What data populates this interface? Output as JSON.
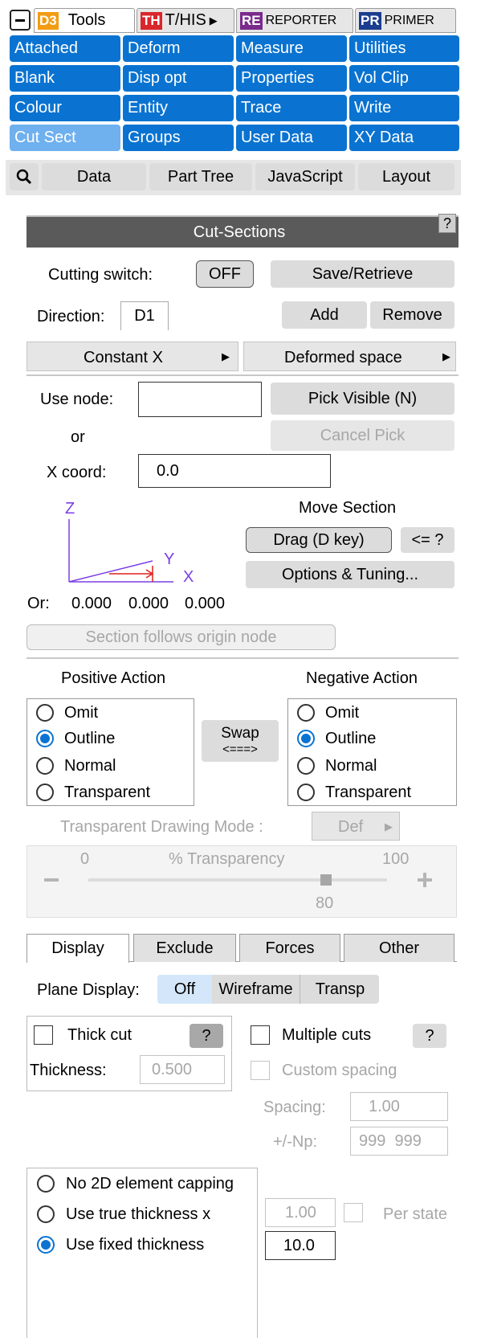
{
  "top_tabs": [
    {
      "logo": "D3",
      "label": "Tools"
    },
    {
      "logo": "TH",
      "label": "T/HIS"
    },
    {
      "logo": "RE",
      "label": "REPORTER"
    },
    {
      "logo": "PR",
      "label": "PRIMER"
    }
  ],
  "menu_grid": [
    "Attached",
    "Deform",
    "Measure",
    "Utilities",
    "Blank",
    "Disp opt",
    "Properties",
    "Vol Clip",
    "Colour",
    "Entity",
    "Trace",
    "Write",
    "Cut Sect",
    "Groups",
    "User Data",
    "XY Data"
  ],
  "bottom_row": [
    "Data",
    "Part Tree",
    "JavaScript",
    "Layout"
  ],
  "panel": {
    "title": "Cut-Sections",
    "help": "?",
    "cutting_switch_label": "Cutting switch:",
    "cutting_switch_value": "OFF",
    "save_retrieve": "Save/Retrieve",
    "direction_label": "Direction:",
    "direction_value": "D1",
    "add": "Add",
    "remove": "Remove",
    "constant_dropdown": "Constant X",
    "space_dropdown": "Deformed space",
    "use_node_label": "Use node:",
    "use_node_value": "",
    "pick_visible": "Pick Visible (N)",
    "or_label": "or",
    "cancel_pick": "Cancel Pick",
    "x_coord_label": "X coord:",
    "x_coord_value": "0.0",
    "move_section_label": "Move Section",
    "drag_button": "Drag (D key)",
    "le_button": "<= ?",
    "options_tuning": "Options & Tuning...",
    "axis_z": "Z",
    "axis_y": "Y",
    "axis_x": "X",
    "origin_label": "Or:",
    "origin_x": "0.000",
    "origin_y": "0.000",
    "origin_z": "0.000",
    "follows_origin": "Section follows origin node",
    "positive_action": "Positive Action",
    "negative_action": "Negative Action",
    "actions": [
      "Omit",
      "Outline",
      "Normal",
      "Transparent"
    ],
    "positive_selected": "Outline",
    "negative_selected": "Outline",
    "swap_line1": "Swap",
    "swap_line2": "<===>",
    "transparent_mode_label": "Transparent Drawing Mode :",
    "transparent_mode_value": "Def",
    "transparency_min": "0",
    "transparency_label": "% Transparency",
    "transparency_max": "100",
    "transparency_value": "80",
    "tabs": [
      "Display",
      "Exclude",
      "Forces",
      "Other"
    ],
    "active_tab": "Display",
    "plane_display_label": "Plane Display:",
    "plane_options": [
      "Off",
      "Wireframe",
      "Transp"
    ],
    "thick_cut_label": "Thick cut",
    "thickness_label": "Thickness:",
    "thickness_value": "0.500",
    "multiple_cuts_label": "Multiple cuts",
    "custom_spacing_label": "Custom spacing",
    "spacing_label": "Spacing:",
    "spacing_value": "1.00",
    "np_label": "+/-Np:",
    "np_value": "999  999",
    "capping": [
      "No 2D element capping",
      "Use true thickness x",
      "Use fixed thickness"
    ],
    "capping_selected": "Use fixed thickness",
    "true_thickness_value": "1.00",
    "per_state_label": "Per state",
    "fixed_thickness_value": "10.0"
  },
  "colors": {
    "accent": "#0a73d1",
    "title_bar": "#5a5a5a",
    "button_grey": "#dcdcdc"
  }
}
